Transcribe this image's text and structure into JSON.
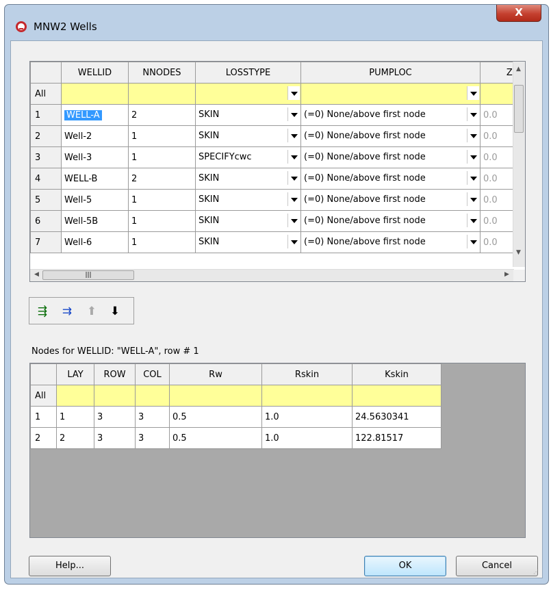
{
  "window": {
    "title": "MNW2 Wells",
    "close_label": "X"
  },
  "wells_grid": {
    "columns": [
      "WELLID",
      "NNODES",
      "LOSSTYPE",
      "PUMPLOC",
      "Zp"
    ],
    "all_row_label": "All",
    "rows": [
      {
        "num": "1",
        "wellid": "WELL-A",
        "nnodes": "2",
        "losstype": "SKIN",
        "pumploc": "(=0) None/above first node",
        "zp": "0.0"
      },
      {
        "num": "2",
        "wellid": "Well-2",
        "nnodes": "1",
        "losstype": "SKIN",
        "pumploc": "(=0) None/above first node",
        "zp": "0.0"
      },
      {
        "num": "3",
        "wellid": "Well-3",
        "nnodes": "1",
        "losstype": "SPECIFYcwc",
        "pumploc": "(=0) None/above first node",
        "zp": "0.0"
      },
      {
        "num": "4",
        "wellid": "WELL-B",
        "nnodes": "2",
        "losstype": "SKIN",
        "pumploc": "(=0) None/above first node",
        "zp": "0.0"
      },
      {
        "num": "5",
        "wellid": "Well-5",
        "nnodes": "1",
        "losstype": "SKIN",
        "pumploc": "(=0) None/above first node",
        "zp": "0.0"
      },
      {
        "num": "6",
        "wellid": "Well-5B",
        "nnodes": "1",
        "losstype": "SKIN",
        "pumploc": "(=0) None/above first node",
        "zp": "0.0"
      },
      {
        "num": "7",
        "wellid": "Well-6",
        "nnodes": "1",
        "losstype": "SKIN",
        "pumploc": "(=0) None/above first node",
        "zp": "0.0"
      }
    ]
  },
  "toolbar": {
    "icons": [
      "insert-row-icon",
      "add-row-icon",
      "move-up-icon",
      "move-down-icon"
    ]
  },
  "nodes_label": "Nodes for WELLID: \"WELL-A\", row # 1",
  "nodes_grid": {
    "columns": [
      "LAY",
      "ROW",
      "COL",
      "Rw",
      "Rskin",
      "Kskin"
    ],
    "all_row_label": "All",
    "rows": [
      {
        "num": "1",
        "lay": "1",
        "row": "3",
        "col": "3",
        "rw": "0.5",
        "rskin": "1.0",
        "kskin": "24.5630341"
      },
      {
        "num": "2",
        "lay": "2",
        "row": "3",
        "col": "3",
        "rw": "0.5",
        "rskin": "1.0",
        "kskin": "122.81517"
      }
    ]
  },
  "buttons": {
    "help": "Help...",
    "ok": "OK",
    "cancel": "Cancel"
  }
}
